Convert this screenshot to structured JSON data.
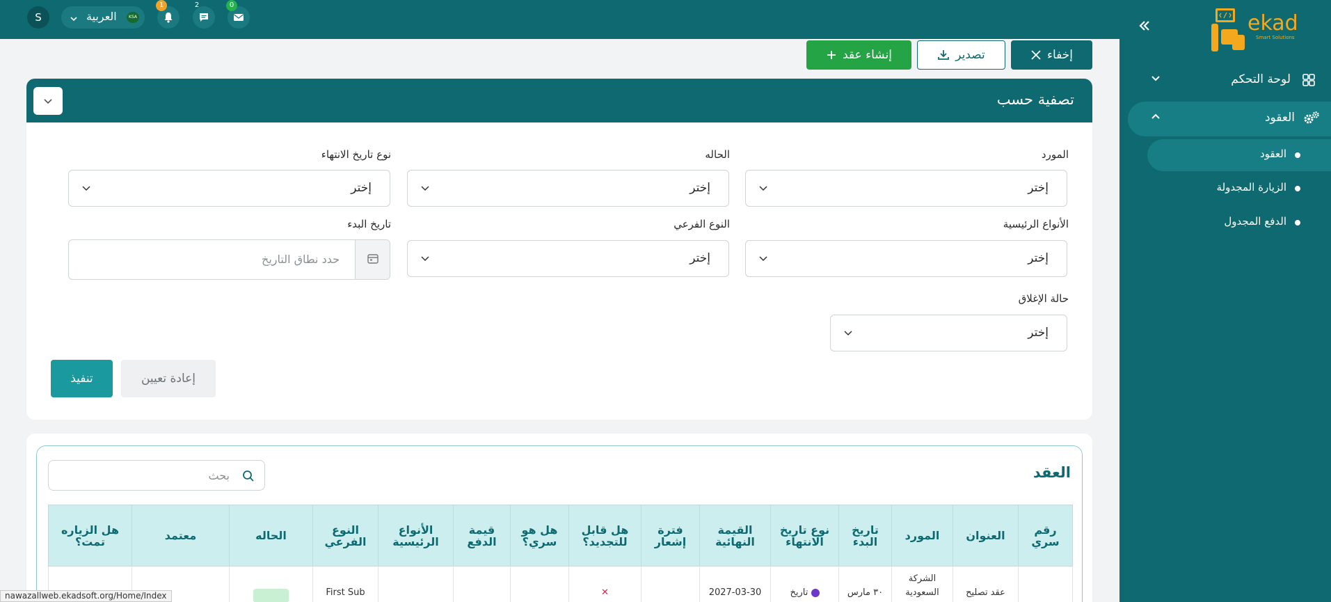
{
  "brand": {
    "name": "ekad",
    "tagline": "Smart Solutions"
  },
  "topbar": {
    "user_initial": "S",
    "language": "العربية",
    "flag_text": "KSA",
    "badges": {
      "notifications": "1",
      "messages": "2",
      "mail": "0"
    }
  },
  "sidebar": {
    "dashboard": "لوحة التحكم",
    "contracts": "العقود",
    "sub_items": [
      "العقود",
      "الزيارة المجدولة",
      "الدفع المجدول"
    ]
  },
  "actions": {
    "hide": "إخفاء",
    "export": "تصدير",
    "create": "إنشاء عقد"
  },
  "filter": {
    "title": "تصفية حسب",
    "fields": {
      "supplier": {
        "label": "المورد",
        "value": "إختر"
      },
      "status": {
        "label": "الحاله",
        "value": "إختر"
      },
      "end_date_type": {
        "label": "نوع تاريخ الانتهاء",
        "value": "إختر"
      },
      "main_types": {
        "label": "الأنواع الرئيسية",
        "value": "إختر"
      },
      "sub_type": {
        "label": "النوع الفرعي",
        "value": "إختر"
      },
      "start_date": {
        "label": "تاريخ البدء",
        "placeholder": "حدد نطاق التاريخ"
      },
      "closing_status": {
        "label": "حالة الإغلاق",
        "value": "إختر"
      }
    },
    "run": "تنفيذ",
    "reset": "إعادة تعيين"
  },
  "table": {
    "title": "العقد",
    "search_placeholder": "بحث",
    "columns": [
      "رقم سري",
      "العنوان",
      "المورد",
      "تاريخ البدء",
      "نوع تاريخ الانتهاء",
      "القيمة النهائية",
      "فترة إشعار",
      "هل قابل للتجديد؟",
      "هل هو سري؟",
      "قيمة الدفع",
      "الأنواع الرئيسية",
      "النوع الفرعي",
      "الحاله",
      "معتمد",
      "هل الزياره تمت؟"
    ],
    "rows": [
      {
        "serial": "",
        "title": "عقد تصليح",
        "supplier": "الشركة السعودية",
        "start": "٣٠ مارس",
        "end_type": "تاريخ",
        "final_date": "2027-03-30",
        "notice": "",
        "renewable": "",
        "secret": "",
        "payment": "",
        "main_types": "",
        "sub_type": "First Sub",
        "status": "",
        "approved": "",
        "visited": ""
      }
    ]
  },
  "status_bar": {
    "url": "nawazallweb.ekadsoft.org/Home/Index"
  }
}
